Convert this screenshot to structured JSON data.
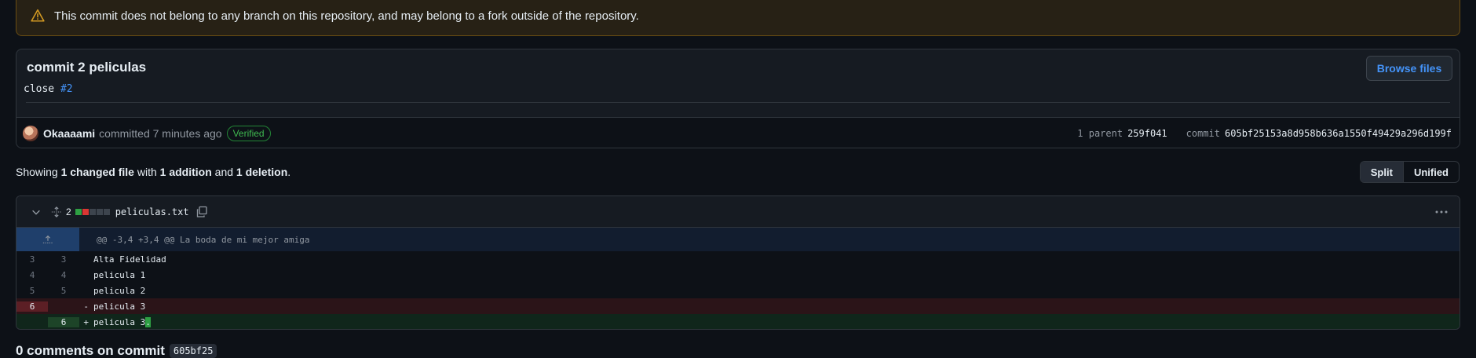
{
  "flash": {
    "message": "This commit does not belong to any branch on this repository, and may belong to a fork outside of the repository."
  },
  "commit": {
    "title": "commit 2 peliculas",
    "desc_text": "close ",
    "desc_link": "#2",
    "browse_label": "Browse files",
    "author": "Okaaaami",
    "action": "committed 7 minutes ago",
    "verified": "Verified",
    "parent_label": "1 parent",
    "parent_sha": "259f041",
    "commit_label": "commit",
    "commit_sha": "605bf25153a8d958b636a1550f49429a296d199f"
  },
  "summary": {
    "showing": "Showing",
    "changed": "1 changed file",
    "with": "with",
    "additions": "1 addition",
    "and": "and",
    "deletions": "1 deletion",
    "period": "."
  },
  "view_toggle": {
    "split": "Split",
    "unified": "Unified"
  },
  "file": {
    "changes": "2",
    "name": "peliculas.txt",
    "hunk": "@@ -3,4 +3,4 @@ La boda de mi mejor amiga",
    "lines": [
      {
        "old": "3",
        "new": "3",
        "sign": "",
        "text": "Alta Fidelidad",
        "type": "ctx"
      },
      {
        "old": "4",
        "new": "4",
        "sign": "",
        "text": "pelicula 1",
        "type": "ctx"
      },
      {
        "old": "5",
        "new": "5",
        "sign": "",
        "text": "pelicula 2",
        "type": "ctx"
      },
      {
        "old": "6",
        "new": "",
        "sign": "-",
        "text": "pelicula 3",
        "type": "del"
      },
      {
        "old": "",
        "new": "6",
        "sign": "+",
        "text": "pelicula 3",
        "type": "add",
        "highlight": "."
      }
    ]
  },
  "comments": {
    "label": "0 comments on commit",
    "sha": "605bf25"
  },
  "colors": {
    "accent": "#4493f8",
    "added": "#2ea043",
    "deleted": "#da3633",
    "warning": "#d29922"
  }
}
